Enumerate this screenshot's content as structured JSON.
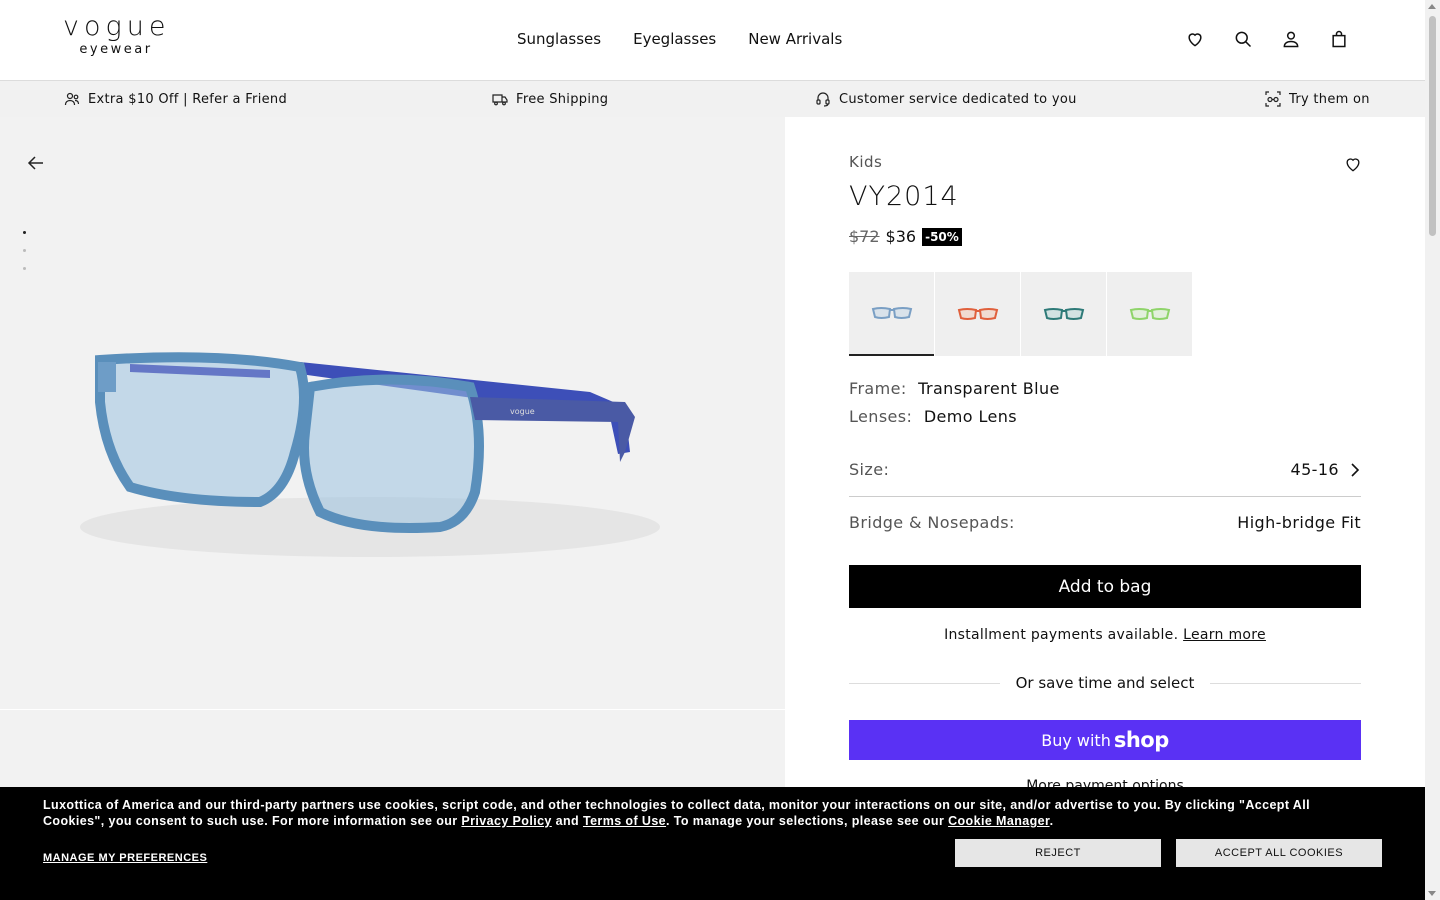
{
  "header": {
    "logo_main": "vogue",
    "logo_sub": "eyewear",
    "nav": [
      "Sunglasses",
      "Eyeglasses",
      "New Arrivals"
    ],
    "icons": [
      "heart-icon",
      "search-icon",
      "user-icon",
      "bag-icon"
    ]
  },
  "benefits": [
    {
      "icon": "refer-icon",
      "label": "Extra $10 Off | Refer a Friend"
    },
    {
      "icon": "truck-icon",
      "label": "Free Shipping"
    },
    {
      "icon": "headset-icon",
      "label": "Customer service dedicated to you"
    },
    {
      "icon": "try-on-icon",
      "label": "Try them on"
    }
  ],
  "gallery": {
    "slides_count": 3,
    "active_slide": 1
  },
  "product": {
    "category": "Kids",
    "title": "VY2014",
    "old_price": "$72",
    "price": "$36",
    "discount": "-50%",
    "swatches": [
      {
        "color": "#7a9fc4",
        "selected": true
      },
      {
        "color": "#e0603c",
        "selected": false
      },
      {
        "color": "#2e7a78",
        "selected": false
      },
      {
        "color": "#8fd46a",
        "selected": false
      }
    ],
    "frame_label": "Frame:",
    "frame_value": "Transparent Blue",
    "lenses_label": "Lenses:",
    "lenses_value": "Demo Lens",
    "size_label": "Size:",
    "size_value": "45-16",
    "bridge_label": "Bridge & Nosepads:",
    "bridge_value": "High-bridge Fit",
    "add_to_bag": "Add to bag",
    "installment_text": "Installment payments available.",
    "installment_link": "Learn more",
    "or_save": "Or save time and select",
    "buy_with": "Buy with",
    "shop_brand": "shop",
    "more_payment": "More payment options"
  },
  "cookie": {
    "text_1": "Luxottica of America and our third-party partners use cookies, script code, and other technologies to collect data, monitor your interactions on our site, and/or advertise to you. By clicking \"Accept All Cookies\", you consent to such use. For more information see our ",
    "privacy_link": "Privacy Policy",
    "and": " and ",
    "terms_link": "Terms of Use",
    "text_2": ". To manage your selections, please see our ",
    "manager_link": "Cookie Manager",
    "text_3": ".",
    "manage_prefs": "MANAGE MY PREFERENCES",
    "reject": "REJECT",
    "accept": "ACCEPT ALL COOKIES"
  },
  "colors": {
    "shop_pay": "#5a31f4",
    "primary": "#000000"
  }
}
